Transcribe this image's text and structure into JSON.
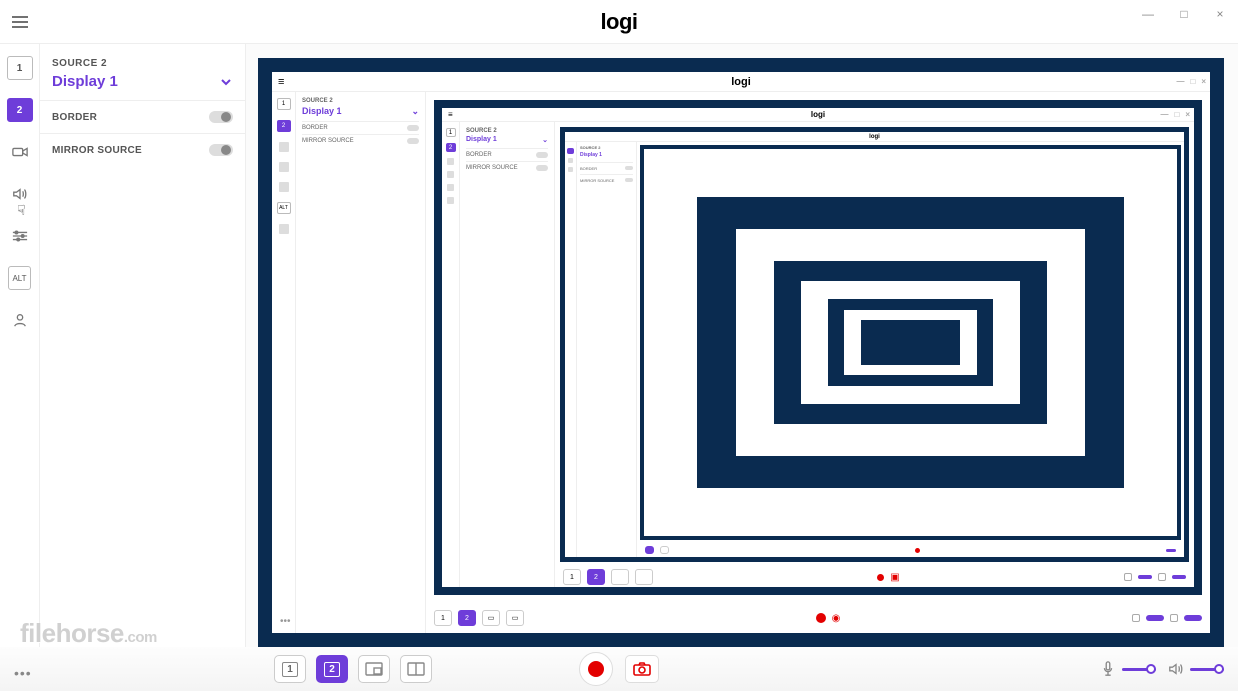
{
  "app": {
    "logo": "logi"
  },
  "window": {
    "minimize": "—",
    "maximize": "□",
    "close": "×"
  },
  "rail": {
    "source1": "1",
    "source2": "2",
    "alt": "ALT"
  },
  "panel": {
    "source_label": "SOURCE 2",
    "display_name": "Display 1",
    "border_label": "BORDER",
    "mirror_label": "MIRROR SOURCE"
  },
  "bottom": {
    "scene1": "1",
    "scene2": "2"
  },
  "watermark": {
    "brand": "filehorse",
    "tld": ".com"
  },
  "colors": {
    "accent": "#6e3dd9",
    "record": "#e30000",
    "frame": "#0a2b50"
  }
}
